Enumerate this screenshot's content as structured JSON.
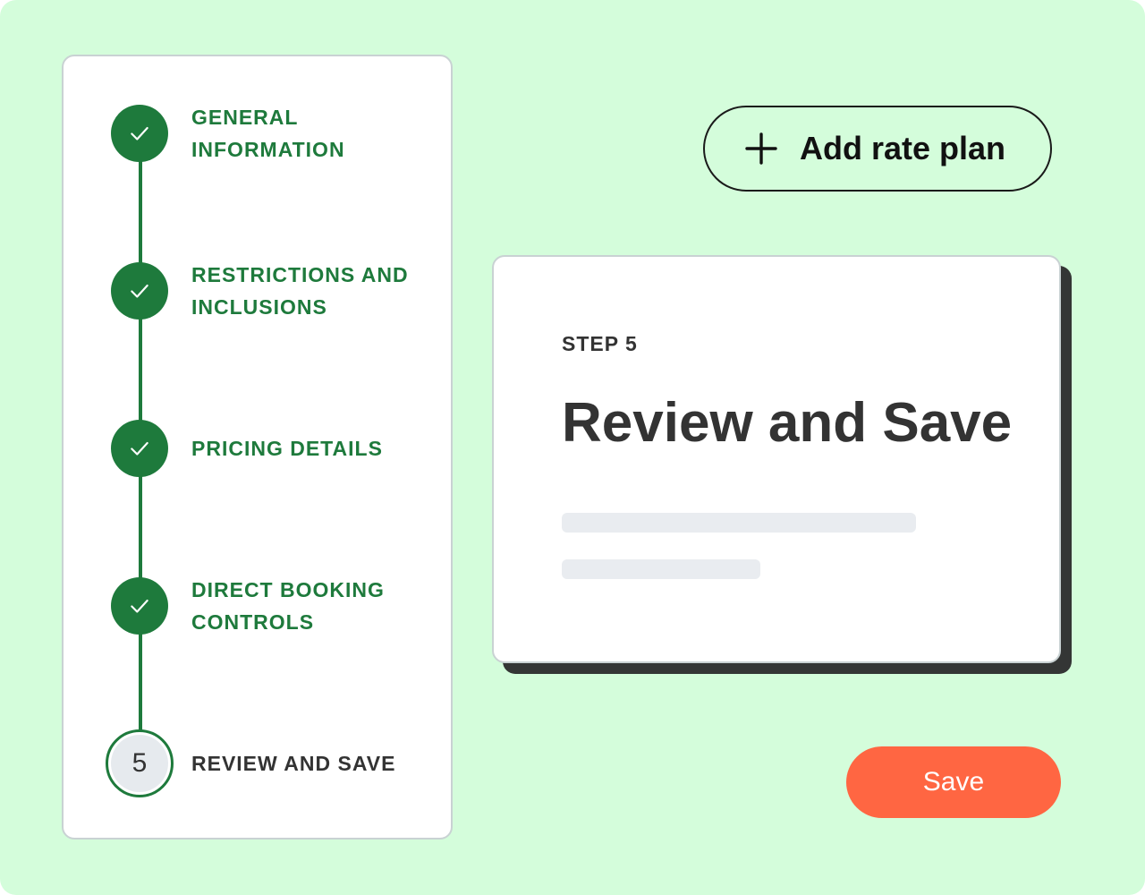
{
  "stepper": {
    "steps": [
      {
        "label_line1": "GENERAL",
        "label_line2": "INFORMATION",
        "status": "complete",
        "icon": "check-icon"
      },
      {
        "label_line1": "RESTRICTIONS AND",
        "label_line2": "INCLUSIONS",
        "status": "complete",
        "icon": "check-icon"
      },
      {
        "label_line1": "PRICING DETAILS",
        "label_line2": "",
        "status": "complete",
        "icon": "check-icon"
      },
      {
        "label_line1": "DIRECT BOOKING",
        "label_line2": "CONTROLS",
        "status": "complete",
        "icon": "check-icon"
      },
      {
        "label_line1": "REVIEW AND SAVE",
        "label_line2": "",
        "status": "current",
        "number": "5"
      }
    ]
  },
  "header": {
    "add_label": "Add rate plan",
    "add_icon": "plus-icon"
  },
  "card": {
    "step_label": "STEP 5",
    "title": "Review and Save"
  },
  "footer": {
    "save_label": "Save"
  },
  "colors": {
    "background": "#d4fddb",
    "accent_green": "#1e7a3c",
    "save_orange": "#ff6642",
    "text_dark": "#333333"
  }
}
